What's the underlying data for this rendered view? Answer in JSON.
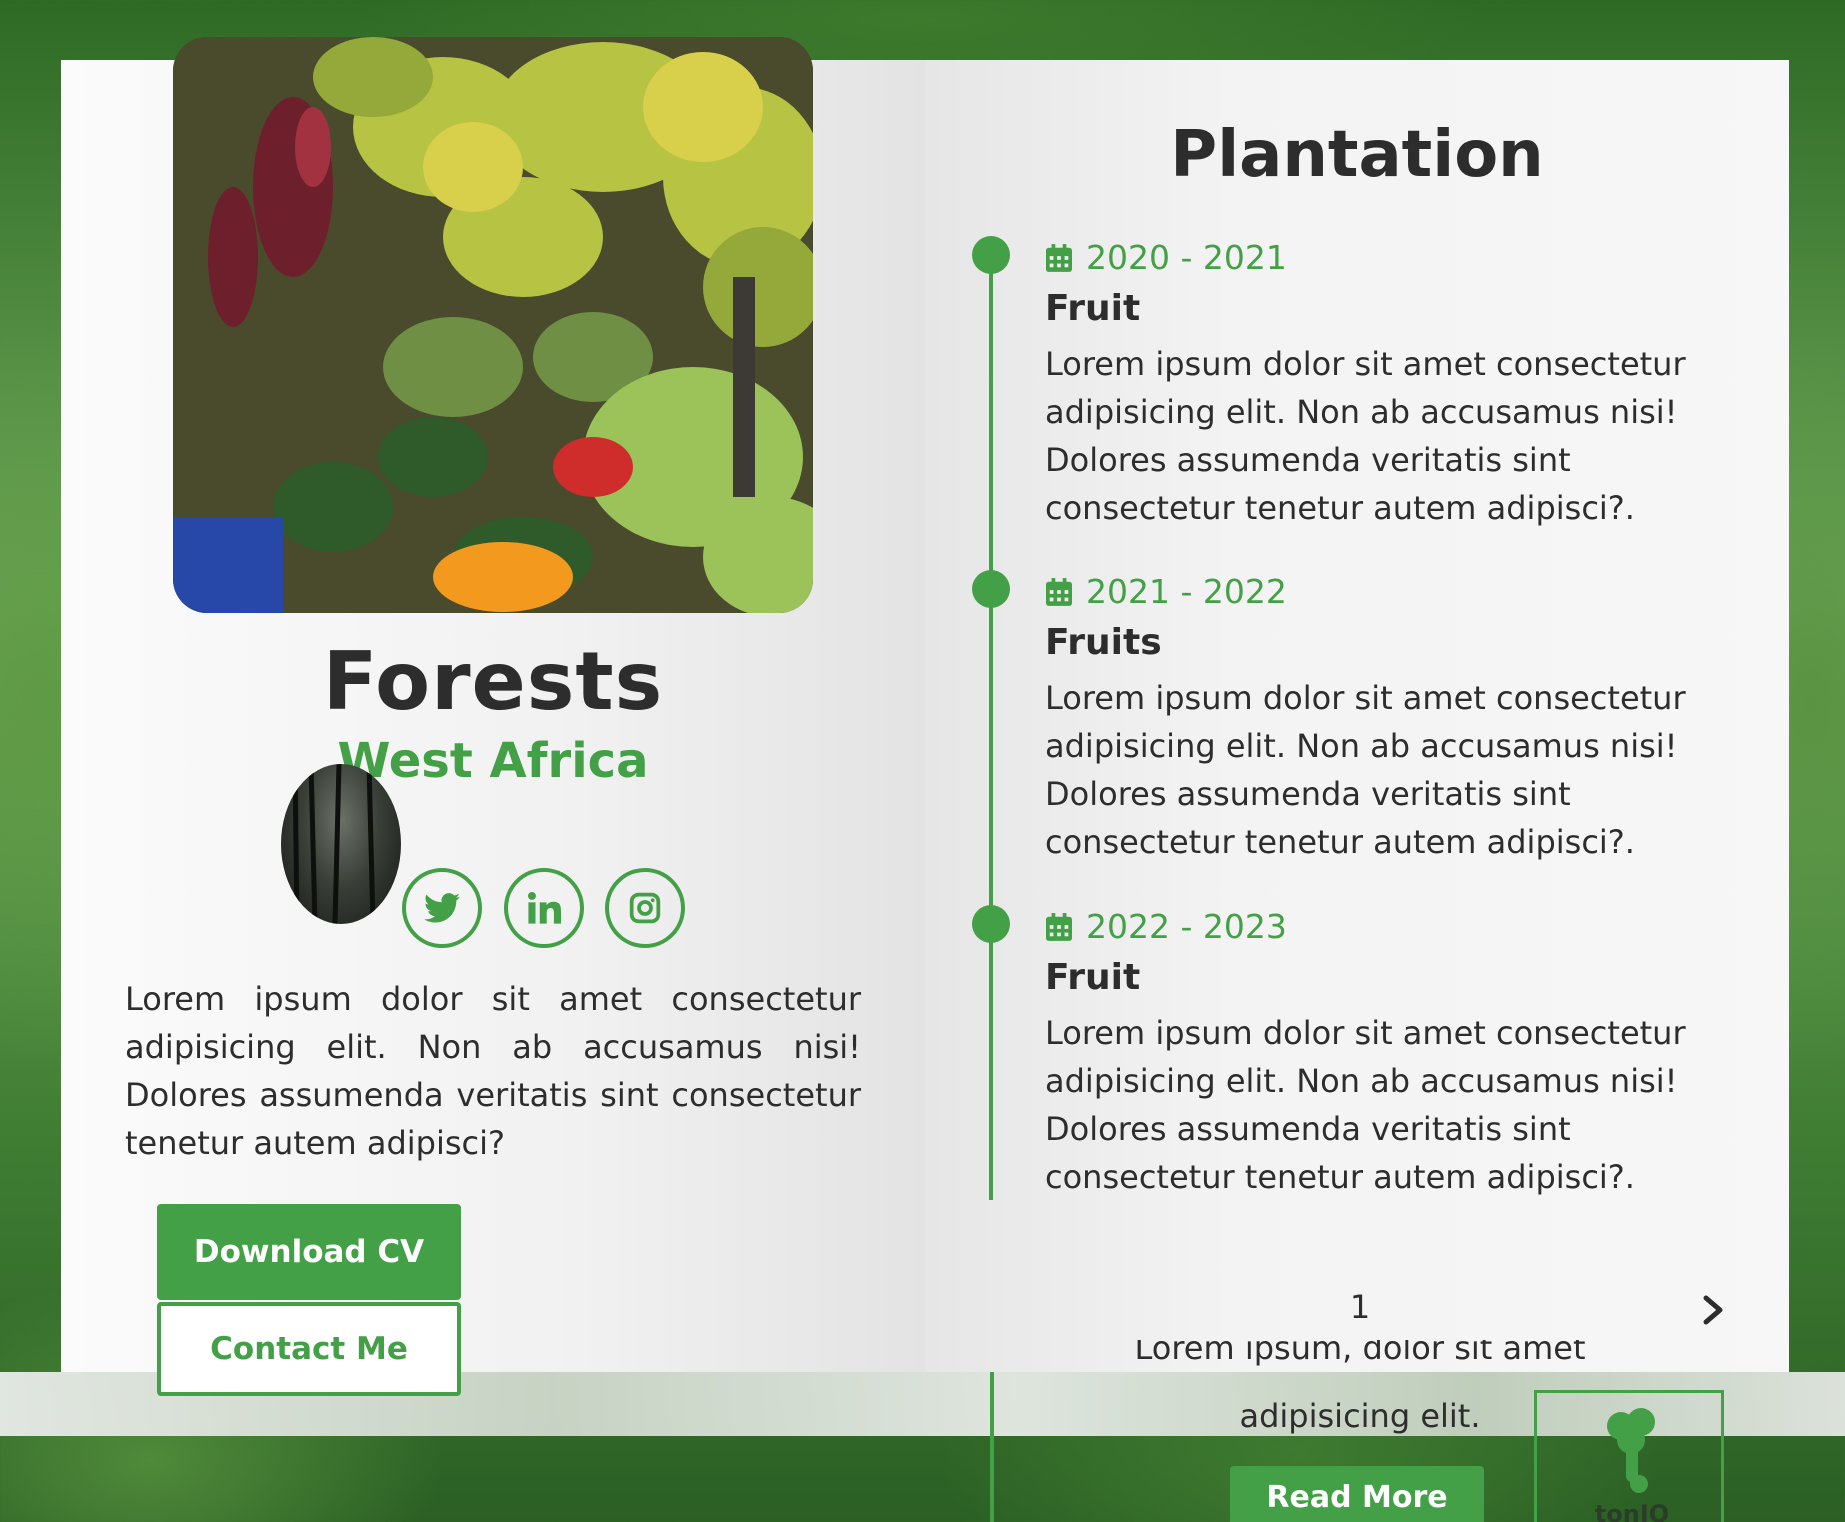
{
  "profile": {
    "title": "Forests",
    "subtitle": "West Africa",
    "bio": "Lorem ipsum dolor sit amet consectetur adipisicing elit. Non ab accusamus nisi! Dolores assumenda veritatis sint consectetur tenetur autem adipisci?",
    "buttons": {
      "download": "Download CV",
      "contact": "Contact Me"
    },
    "social": [
      "twitter-icon",
      "linkedin-icon",
      "instagram-icon"
    ]
  },
  "plantation": {
    "title": "Plantation",
    "items": [
      {
        "date": "2020 - 2021",
        "heading": "Fruit",
        "text": "Lorem ipsum dolor sit amet consectetur adipisicing elit. Non ab accusamus nisi! Dolores assumenda veritatis sint consectetur tenetur autem adipisci?."
      },
      {
        "date": "2021 - 2022",
        "heading": "Fruits",
        "text": "Lorem ipsum dolor sit amet consectetur adipisicing elit. Non ab accusamus nisi! Dolores assumenda veritatis sint consectetur tenetur autem adipisci?."
      },
      {
        "date": "2022 - 2023",
        "heading": "Fruit",
        "text": "Lorem ipsum dolor sit amet consectetur adipisicing elit. Non ab accusamus nisi! Dolores assumenda veritatis sint consectetur tenetur autem adipisci?."
      }
    ],
    "page_number": "1"
  },
  "bottom": {
    "snippet_cut": "Lorem ipsum, dolor sit amet consectetur",
    "snippet": "adipisicing elit.",
    "read_more": "Read More",
    "tree_caption": "tonIQ"
  },
  "colors": {
    "accent": "#43a047",
    "text": "#2d2d2d"
  }
}
